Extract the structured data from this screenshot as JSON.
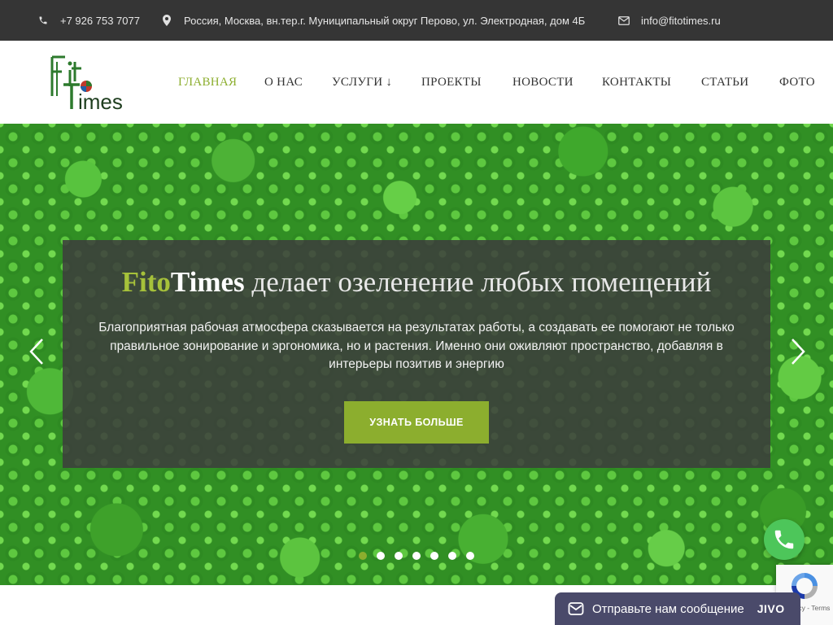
{
  "topbar": {
    "phone": "+7 926 753 7077",
    "address": "Россия, Москва, вн.тер.г. Муниципальный округ Перово, ул. Электродная,  дом 4Б",
    "email": "info@fitotimes.ru"
  },
  "header": {
    "logo_top": "Fi",
    "logo_bottom": "Times",
    "nav": [
      {
        "label": "ГЛАВНАЯ",
        "active": true
      },
      {
        "label": "О НАС"
      },
      {
        "label": "УСЛУГИ ↓"
      },
      {
        "label": "ПРОЕКТЫ"
      },
      {
        "label": "НОВОСТИ"
      },
      {
        "label": "КОНТАКТЫ"
      },
      {
        "label": "СТАТЬИ"
      },
      {
        "label": "ФОТО"
      }
    ]
  },
  "hero": {
    "title_brand_a": "Fito",
    "title_brand_b": "Times",
    "title_rest": " делает озеленение любых помещений",
    "text": "Благоприятная рабочая атмосфера сказывается на результатах работы, а создавать ее помогают не только правильное зонирование и эргономика, но и растения. Именно они оживляют пространство, добавляя в интерьеры позитив и энергию",
    "button": "УЗНАТЬ БОЛЬШЕ",
    "slide_count": 7,
    "active_slide": 1
  },
  "widgets": {
    "jivo_label": "Отправьте нам сообщение",
    "jivo_brand": "JIVO",
    "recaptcha_terms": "Privacy - Terms"
  },
  "colors": {
    "accent": "#8cae2e",
    "topbar_bg": "#353535",
    "whatsapp": "#4dc65a",
    "jivo_bg": "#4a4a6a"
  }
}
